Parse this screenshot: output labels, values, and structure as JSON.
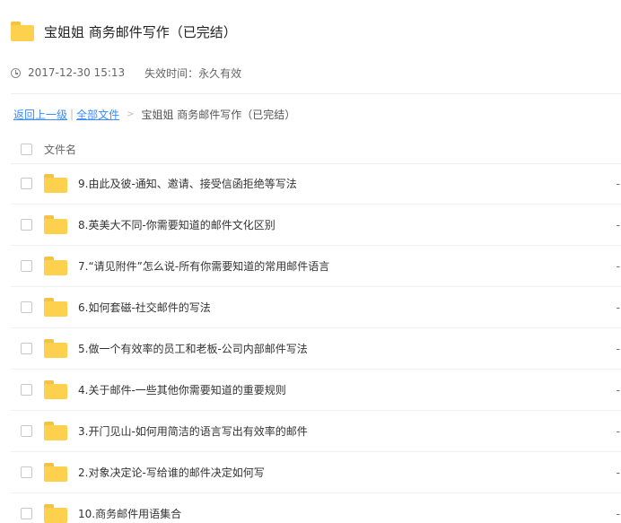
{
  "header": {
    "title": "宝姐姐 商务邮件写作（已完结）",
    "folder_icon": "folder-icon"
  },
  "meta": {
    "clock_icon": "clock-icon",
    "date": "2017-12-30 15:13",
    "expire": "失效时间：永久有效"
  },
  "breadcrumb": {
    "back": "返回上一级",
    "sep1": "|",
    "all": "全部文件",
    "sep2": ">",
    "current": "宝姐姐 商务邮件写作（已完结）"
  },
  "list_header": {
    "filename": "文件名"
  },
  "files": [
    {
      "name": "9.由此及彼-通知、邀请、接受信函拒绝等写法",
      "size": "-"
    },
    {
      "name": "8.英美大不同-你需要知道的邮件文化区别",
      "size": "-"
    },
    {
      "name": "7.“请见附件”怎么说-所有你需要知道的常用邮件语言",
      "size": "-"
    },
    {
      "name": "6.如何套磁-社交邮件的写法",
      "size": "-"
    },
    {
      "name": "5.做一个有效率的员工和老板-公司内部邮件写法",
      "size": "-"
    },
    {
      "name": "4.关于邮件-一些其他你需要知道的重要规则",
      "size": "-"
    },
    {
      "name": "3.开门见山-如何用简洁的语言写出有效率的邮件",
      "size": "-"
    },
    {
      "name": "2.对象决定论-写给谁的邮件决定如何写",
      "size": "-"
    },
    {
      "name": "10.商务邮件用语集合",
      "size": "-"
    }
  ],
  "colors": {
    "folder": "#fdd14d",
    "folder_tab": "#f5c344",
    "link": "#3b8cff"
  }
}
